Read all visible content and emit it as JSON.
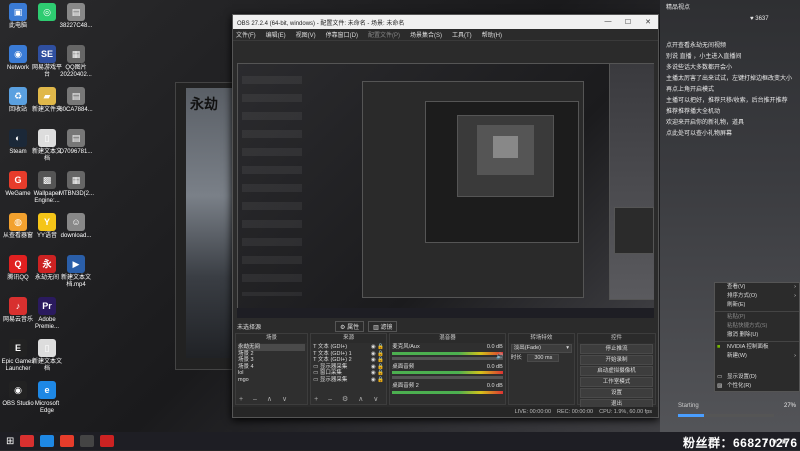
{
  "desktop": {
    "icons": [
      {
        "label": "此电脑",
        "color": "#3a7bd5",
        "glyph": "▣"
      },
      {
        "label": "",
        "color": "#2ecc71",
        "glyph": "◎"
      },
      {
        "label": "38227C48...",
        "color": "#888",
        "glyph": "▤"
      },
      {
        "label": "Network",
        "color": "#3a7bd5",
        "glyph": "◉"
      },
      {
        "label": "网易游戏平台",
        "color": "#2f4f9f",
        "glyph": "SE"
      },
      {
        "label": "QQ图片20220402...",
        "color": "#666",
        "glyph": "▦"
      },
      {
        "label": "回收站",
        "color": "#5aa0e0",
        "glyph": "♻"
      },
      {
        "label": "新建文件夹",
        "color": "#e0b84a",
        "glyph": "▰"
      },
      {
        "label": "80CA7884...",
        "color": "#777",
        "glyph": "▤"
      },
      {
        "label": "Steam",
        "color": "#1b2838",
        "glyph": "◐"
      },
      {
        "label": "新建文本文档",
        "color": "#ddd",
        "glyph": "▯"
      },
      {
        "label": "D7096781...",
        "color": "#777",
        "glyph": "▤"
      },
      {
        "label": "WeGame",
        "color": "#e63c2b",
        "glyph": "G"
      },
      {
        "label": "Wallpaper Engine:...",
        "color": "#555",
        "glyph": "▩"
      },
      {
        "label": "MTBN3D(2...",
        "color": "#666",
        "glyph": "▦"
      },
      {
        "label": "从查看器窗",
        "color": "#f2a12e",
        "glyph": "◍"
      },
      {
        "label": "YY语音",
        "color": "#f5c518",
        "glyph": "Y"
      },
      {
        "label": "download...",
        "color": "#888",
        "glyph": "☺"
      },
      {
        "label": "腾讯QQ",
        "color": "#e02020",
        "glyph": "Q"
      },
      {
        "label": "永劫无间",
        "color": "#c22",
        "glyph": "永"
      },
      {
        "label": "新建文本文档.mp4",
        "color": "#2a5ea8",
        "glyph": "▶"
      },
      {
        "label": "网易云音乐",
        "color": "#d8302f",
        "glyph": "♪"
      },
      {
        "label": "Adobe Premie...",
        "color": "#2a1a5e",
        "glyph": "Pr"
      },
      {
        "label": "",
        "color": "transparent",
        "glyph": ""
      },
      {
        "label": "Epic Games Launcher",
        "color": "#222",
        "glyph": "E"
      },
      {
        "label": "新建文本文档",
        "color": "#ddd",
        "glyph": "▯"
      },
      {
        "label": "",
        "color": "transparent",
        "glyph": ""
      },
      {
        "label": "OBS Studio",
        "color": "#222",
        "glyph": "◉"
      },
      {
        "label": "Microsoft Edge",
        "color": "#1e88e5",
        "glyph": "e"
      }
    ]
  },
  "obs": {
    "title": "OBS 27.2.4 (64-bit, windows) - 配置文件: 未命名 - 场景: 未命名",
    "menu": [
      "文件(F)",
      "编辑(E)",
      "视图(V)",
      "停靠窗口(D)",
      "配置文件(P)",
      "场景集合(S)",
      "工具(T)",
      "帮助(H)"
    ],
    "no_source": "未选择源",
    "props_label": "属性",
    "filters_label": "滤镜",
    "docks": {
      "scenes": {
        "title": "场景",
        "items": [
          "永劫无间",
          "场景 2",
          "场景 3",
          "场景 4",
          "lol",
          "mgo"
        ]
      },
      "sources": {
        "title": "来源",
        "items": [
          "文本 (GDI+)",
          "文本 (GDI+) 1",
          "文本 (GDI+) 2",
          "显示器采集",
          "窗口采集",
          "显示器采集"
        ]
      },
      "mixer": {
        "title": "混音器",
        "channels": [
          {
            "name": "麦克风/Aux",
            "db": "0.0 dB"
          },
          {
            "name": "桌面音频",
            "db": "0.0 dB"
          },
          {
            "name": "桌面音频 2",
            "db": "0.0 dB"
          }
        ]
      },
      "transitions": {
        "title": "转场特效",
        "type": "淡出(Fade)",
        "duration_label": "时长",
        "duration": "300 ms"
      },
      "controls": {
        "title": "控件",
        "buttons": [
          "停止推流",
          "开始录制",
          "启动虚拟摄像机",
          "工作室模式",
          "设置",
          "退出"
        ]
      }
    },
    "status": {
      "live": "LIVE: 00:00:00",
      "rec": "REC: 00:00:00",
      "cpu": "CPU: 1.9%, 60.00 fps"
    }
  },
  "right_panel": {
    "header": "精品视点",
    "count": "3637",
    "chat": [
      "点开查看永劫无间视频",
      "别说 直播 ，小主进入直播间",
      "多说些话大多数都开会小",
      "主播太厉害了出来试试，左键打掉边框改变大小",
      "再点上角开启模式",
      "主播可以把好，推荐只移/收索，后台推开推荐",
      "推荐推荐播大全机动",
      "欢迎来开启你的新礼物，道具",
      "点此处可以查小礼物屏幕"
    ],
    "progress_label": "Starting",
    "progress_pct": "27%",
    "fans": "粉丝群：668270276"
  },
  "context_menu": {
    "items": [
      "查看(V)",
      "排序方式(O)",
      "刷新(E)",
      "粘贴(P)",
      "粘贴快捷方式(S)",
      "撤消 删除(U)",
      "NVIDIA 控制面板",
      "新建(W)",
      "显示设置(D)",
      "个性化(R)"
    ]
  }
}
